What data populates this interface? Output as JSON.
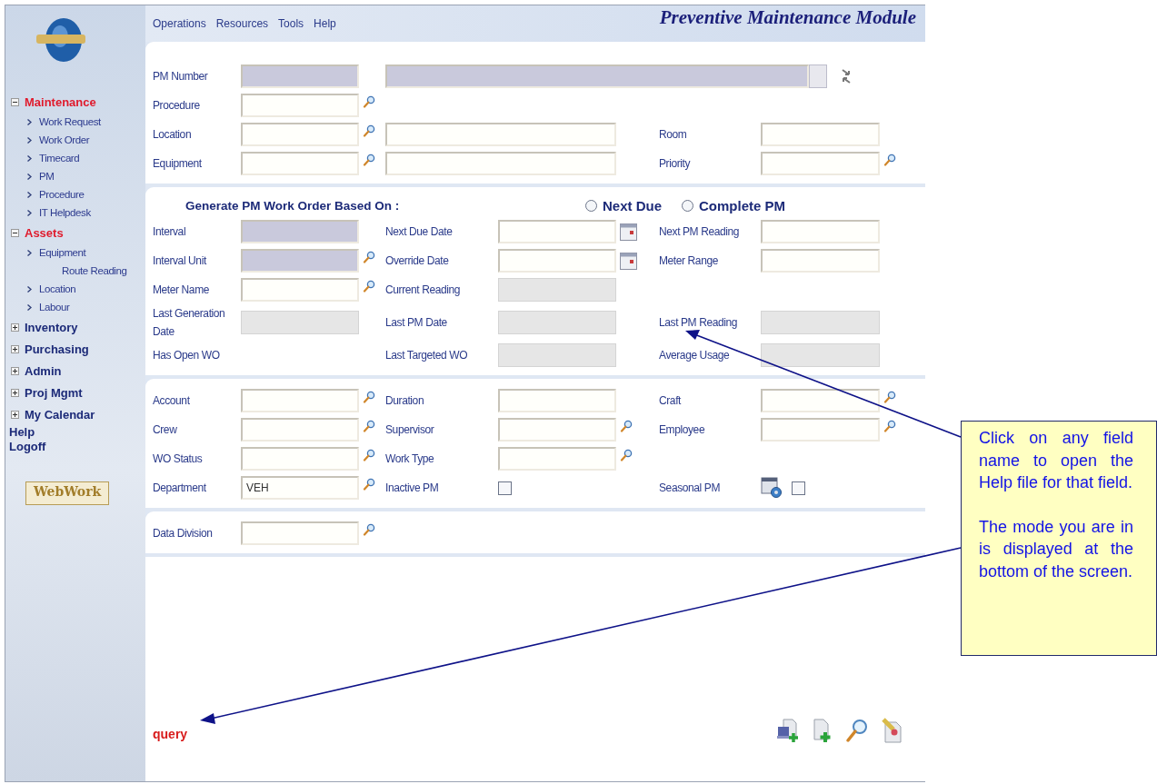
{
  "menu_bar": {
    "items": [
      "Operations",
      "Resources",
      "Tools",
      "Help"
    ],
    "title": "Preventive Maintenance Module"
  },
  "sidebar": {
    "groups": [
      {
        "label": "Maintenance",
        "expanded": true,
        "children": [
          {
            "label": "Work Request"
          },
          {
            "label": "Work Order"
          },
          {
            "label": "Timecard"
          },
          {
            "label": "PM"
          },
          {
            "label": "Procedure"
          },
          {
            "label": "IT Helpdesk"
          }
        ]
      },
      {
        "label": "Assets",
        "expanded": true,
        "children": [
          {
            "label": "Equipment",
            "children": [
              {
                "label": "Route Reading"
              }
            ]
          },
          {
            "label": "Location"
          },
          {
            "label": "Labour"
          }
        ]
      },
      {
        "label": "Inventory",
        "expanded": false
      },
      {
        "label": "Purchasing",
        "expanded": false
      },
      {
        "label": "Admin",
        "expanded": false
      },
      {
        "label": "Proj Mgmt",
        "expanded": false
      },
      {
        "label": "My Calendar",
        "expanded": false
      }
    ],
    "links": [
      "Help",
      "Logoff"
    ],
    "badge": "WebWork"
  },
  "form": {
    "sections": [
      {
        "rows": [
          [
            {
              "kind": "field",
              "label": "PM Number",
              "locked": true,
              "read_only": false
            },
            {
              "kind": "long-field",
              "locked": true,
              "read_only": false
            }
          ],
          [
            {
              "kind": "field",
              "label": "Procedure",
              "locked": false,
              "read_only": false,
              "lookup": true
            }
          ],
          [
            {
              "kind": "field",
              "label": "Location",
              "locked": false,
              "read_only": false,
              "lookup": true
            },
            {
              "kind": "wide-field",
              "locked": false,
              "read_only": false
            },
            {
              "kind": "field",
              "label": "Room",
              "locked": false,
              "read_only": false
            }
          ],
          [
            {
              "kind": "field",
              "label": "Equipment",
              "locked": false,
              "read_only": false,
              "lookup": true
            },
            {
              "kind": "wide-field",
              "locked": false,
              "read_only": false
            },
            {
              "kind": "field",
              "label": "Priority",
              "locked": false,
              "read_only": false,
              "lookup": true
            }
          ]
        ]
      },
      {
        "heading": "Generate PM Work Order Based On :",
        "options": [
          {
            "label": "Next Due",
            "selected": false
          },
          {
            "label": "Complete PM",
            "selected": false
          }
        ],
        "rows": [
          [
            {
              "kind": "field",
              "label": "Interval",
              "locked": true,
              "read_only": false
            },
            {
              "kind": "field",
              "label": "Next Due Date",
              "locked": false,
              "read_only": false,
              "calendar": true
            },
            {
              "kind": "field",
              "label": "Next PM Reading",
              "locked": false,
              "read_only": false
            }
          ],
          [
            {
              "kind": "field",
              "label": "Interval Unit",
              "locked": true,
              "read_only": false,
              "lookup": true
            },
            {
              "kind": "field",
              "label": "Override Date",
              "locked": false,
              "read_only": false,
              "calendar": true
            },
            {
              "kind": "field",
              "label": "Meter Range",
              "locked": false,
              "read_only": false
            }
          ],
          [
            {
              "kind": "field",
              "label": "Meter Name",
              "locked": false,
              "read_only": false,
              "lookup": true
            },
            {
              "kind": "field",
              "label": "Current Reading",
              "locked": false,
              "read_only": true
            },
            {
              "kind": "empty"
            }
          ],
          [
            {
              "kind": "field",
              "label": "Last Generation Date",
              "locked": false,
              "read_only": true
            },
            {
              "kind": "field",
              "label": "Last PM Date",
              "locked": false,
              "read_only": true
            },
            {
              "kind": "field",
              "label": "Last PM Reading",
              "locked": false,
              "read_only": true
            }
          ],
          [
            {
              "kind": "label",
              "label": "Has Open WO"
            },
            {
              "kind": "field",
              "label": "Last Targeted WO",
              "locked": false,
              "read_only": true
            },
            {
              "kind": "field",
              "label": "Average Usage",
              "locked": false,
              "read_only": true
            }
          ]
        ]
      },
      {
        "rows": [
          [
            {
              "kind": "field",
              "label": "Account",
              "locked": false,
              "read_only": false,
              "lookup": true
            },
            {
              "kind": "field",
              "label": "Duration",
              "locked": false,
              "read_only": false
            },
            {
              "kind": "field",
              "label": "Craft",
              "locked": false,
              "read_only": false,
              "lookup": true
            }
          ],
          [
            {
              "kind": "field",
              "label": "Crew",
              "locked": false,
              "read_only": false,
              "lookup": true
            },
            {
              "kind": "field",
              "label": "Supervisor",
              "locked": false,
              "read_only": false,
              "lookup": true
            },
            {
              "kind": "field",
              "label": "Employee",
              "locked": false,
              "read_only": false,
              "lookup": true
            }
          ],
          [
            {
              "kind": "field",
              "label": "WO Status",
              "locked": false,
              "read_only": false,
              "lookup": true
            },
            {
              "kind": "field",
              "label": "Work Type",
              "locked": false,
              "read_only": false,
              "lookup": true
            },
            {
              "kind": "empty"
            }
          ],
          [
            {
              "kind": "field",
              "label": "Department",
              "locked": false,
              "read_only": false,
              "lookup": true,
              "value": "VEH"
            },
            {
              "kind": "checkbox",
              "label": "Inactive PM",
              "checked": false
            },
            {
              "kind": "schedule-checkbox",
              "label": "Seasonal PM",
              "checked": false
            }
          ]
        ]
      },
      {
        "rows": [
          [
            {
              "kind": "field",
              "label": "Data Division",
              "locked": false,
              "read_only": false,
              "lookup": true
            }
          ]
        ]
      }
    ]
  },
  "mode": "query",
  "callout": {
    "paragraphs": [
      "Click on any field name to open the Help file for that field.",
      "The mode you are in is displayed at the bottom of the screen."
    ]
  }
}
